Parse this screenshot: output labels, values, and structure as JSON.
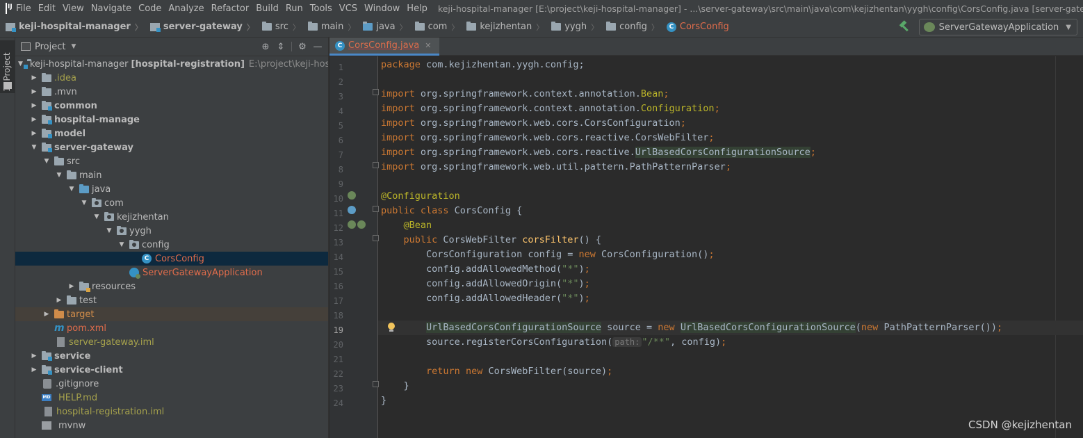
{
  "menubar": {
    "items": [
      "File",
      "Edit",
      "View",
      "Navigate",
      "Code",
      "Analyze",
      "Refactor",
      "Build",
      "Run",
      "Tools",
      "VCS",
      "Window",
      "Help"
    ],
    "title": "keji-hospital-manager [E:\\project\\keji-hospital-manager] - ...\\server-gateway\\src\\main\\java\\com\\kejizhentan\\yygh\\config\\CorsConfig.java [server-gateway] - IntelliJ IDEA"
  },
  "navbar": {
    "crumbs": [
      "keji-hospital-manager",
      "server-gateway",
      "src",
      "main",
      "java",
      "com",
      "kejizhentan",
      "yygh",
      "config",
      "CorsConfig"
    ],
    "run_config": "ServerGatewayApplication"
  },
  "stripe": {
    "label": "1: Project"
  },
  "project_panel": {
    "title": "Project",
    "tree": {
      "root_name": "keji-hospital-manager",
      "root_module": "[hospital-registration]",
      "root_path": "E:\\project\\keji-hospital-",
      "idea": ".idea",
      "mvn": ".mvn",
      "common": "common",
      "hospital_manage": "hospital-manage",
      "model": "model",
      "server_gateway": "server-gateway",
      "src": "src",
      "main": "main",
      "java": "java",
      "com": "com",
      "kejizhentan": "kejizhentan",
      "yygh": "yygh",
      "config": "config",
      "cors_config": "CorsConfig",
      "app": "ServerGatewayApplication",
      "resources": "resources",
      "test": "test",
      "target": "target",
      "pom": "pom.xml",
      "iml": "server-gateway.iml",
      "service": "service",
      "service_client": "service-client",
      "gitignore": ".gitignore",
      "help": "HELP.md",
      "reg_iml": "hospital-registration.iml",
      "mvnw": "mvnw"
    }
  },
  "editor": {
    "tab_label": "CorsConfig.java",
    "line_numbers": [
      "1",
      "2",
      "3",
      "4",
      "5",
      "6",
      "7",
      "8",
      "9",
      "10",
      "11",
      "12",
      "13",
      "14",
      "15",
      "16",
      "17",
      "18",
      "19",
      "20",
      "21",
      "22",
      "23",
      "24"
    ],
    "param_hint": "path:",
    "code": {
      "l1_kw": "package",
      "l1_rest": " com.kejizhentan.yygh.config;",
      "imp": "import",
      "l3_a": " org.springframework.context.annotation.",
      "l3_b": "Bean",
      "l3_c": ";",
      "l4_a": " org.springframework.context.annotation.",
      "l4_b": "Configuration",
      "l4_c": ";",
      "l5_a": " org.springframework.web.cors.CorsConfiguration",
      "l5_c": ";",
      "l6_a": " org.springframework.web.cors.reactive.CorsWebFilter",
      "l6_c": ";",
      "l7_a": " org.springframework.web.cors.reactive.",
      "l7_b": "UrlBasedCorsConfigurationSource",
      "l7_c": ";",
      "l8_a": " org.springframework.web.util.pattern.PathPatternParser",
      "l8_c": ";",
      "l10": "@Configuration",
      "l11_kw": "public class",
      "l11_rest": " CorsConfig {",
      "l12": "    @Bean",
      "l13_kw": "    public",
      "l13_a": " CorsWebFilter ",
      "l13_fn": "corsFilter",
      "l13_b": "() {",
      "l14_a": "        CorsConfiguration config = ",
      "l14_kw": "new",
      "l14_b": " CorsConfiguration()",
      "l14_c": ";",
      "l15_a": "        config.addAllowedMethod(",
      "l15_s": "\"*\"",
      "l15_b": ")",
      "l15_c": ";",
      "l16_a": "        config.addAllowedOrigin(",
      "l16_s": "\"*\"",
      "l16_b": ")",
      "l16_c": ";",
      "l17_a": "        config.addAllowedHeader(",
      "l17_s": "\"*\"",
      "l17_b": ")",
      "l17_c": ";",
      "l19_pre": "        ",
      "l19_hl1": "UrlBasedCorsConfigurationSource",
      "l19_a": " source = ",
      "l19_kw1": "new",
      "l19_sp": " ",
      "l19_hl2": "UrlBasedCorsConfigurationSource",
      "l19_b": "(",
      "l19_kw2": "new",
      "l19_c": " PathPatternParser())",
      "l19_d": ";",
      "l20_a": "        source.registerCorsConfiguration(",
      "l20_s": "\"/**\"",
      "l20_b": ", config)",
      "l20_c": ";",
      "l22_kw1": "        return",
      "l22_sp": " ",
      "l22_kw2": "new",
      "l22_a": " CorsWebFilter(source)",
      "l22_c": ";",
      "l23": "    }",
      "l24": "}"
    }
  },
  "watermark": "CSDN @kejizhentan"
}
